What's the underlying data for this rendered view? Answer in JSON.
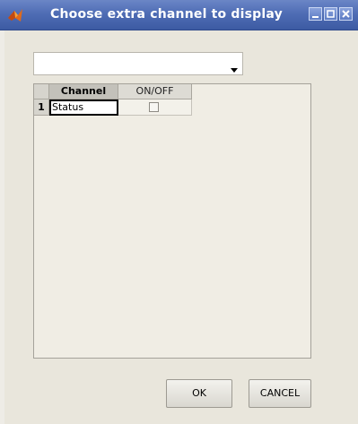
{
  "window": {
    "title": "Choose extra channel to display",
    "title_bar_color": "#4f6db5"
  },
  "channel_select": {
    "selected_value": ""
  },
  "table": {
    "columns": [
      "Channel",
      "ON/OFF"
    ],
    "rows": [
      {
        "index": "1",
        "channel": "Status",
        "on_off": false
      }
    ]
  },
  "buttons": {
    "ok_label": "OK",
    "cancel_label": "CANCEL"
  },
  "icons": {
    "app": "matlab-icon",
    "minimize": "minimize-icon",
    "maximize": "maximize-icon",
    "close": "close-icon",
    "dropdown": "chevron-down-icon"
  }
}
